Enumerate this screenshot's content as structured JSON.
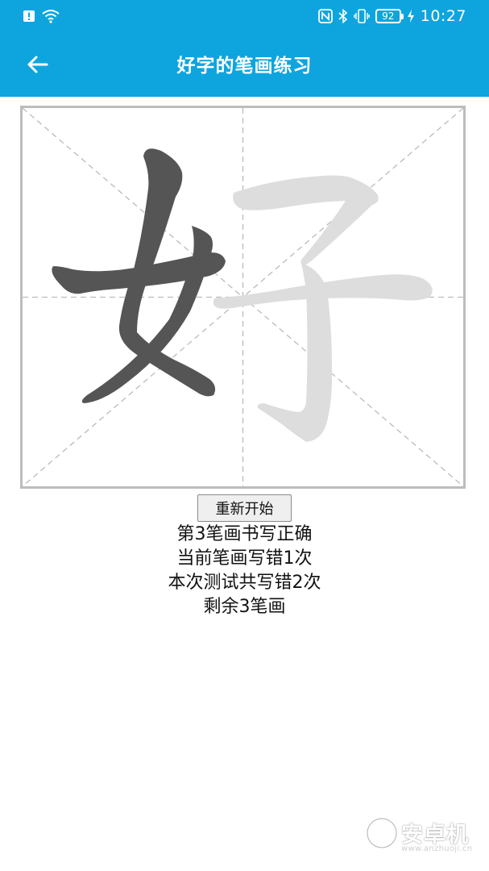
{
  "status_bar": {
    "battery_level": "92",
    "time": "10:27"
  },
  "app_bar": {
    "title": "好字的笔画练习"
  },
  "writer": {
    "character": "好",
    "completed_strokes": 3,
    "total_strokes": 6,
    "stroke_color": "#555555",
    "outline_color": "#dddddd",
    "grid_color": "#bbbbbb"
  },
  "controls": {
    "restart_label": "重新开始"
  },
  "feedback": {
    "stroke_result": "第3笔画书写正确",
    "current_errors": "当前笔画写错1次",
    "total_errors": "本次测试共写错2次",
    "remaining": "剩余3笔画"
  },
  "watermark": {
    "brand": "安卓机",
    "url": "www.anzhuoji.cn"
  }
}
